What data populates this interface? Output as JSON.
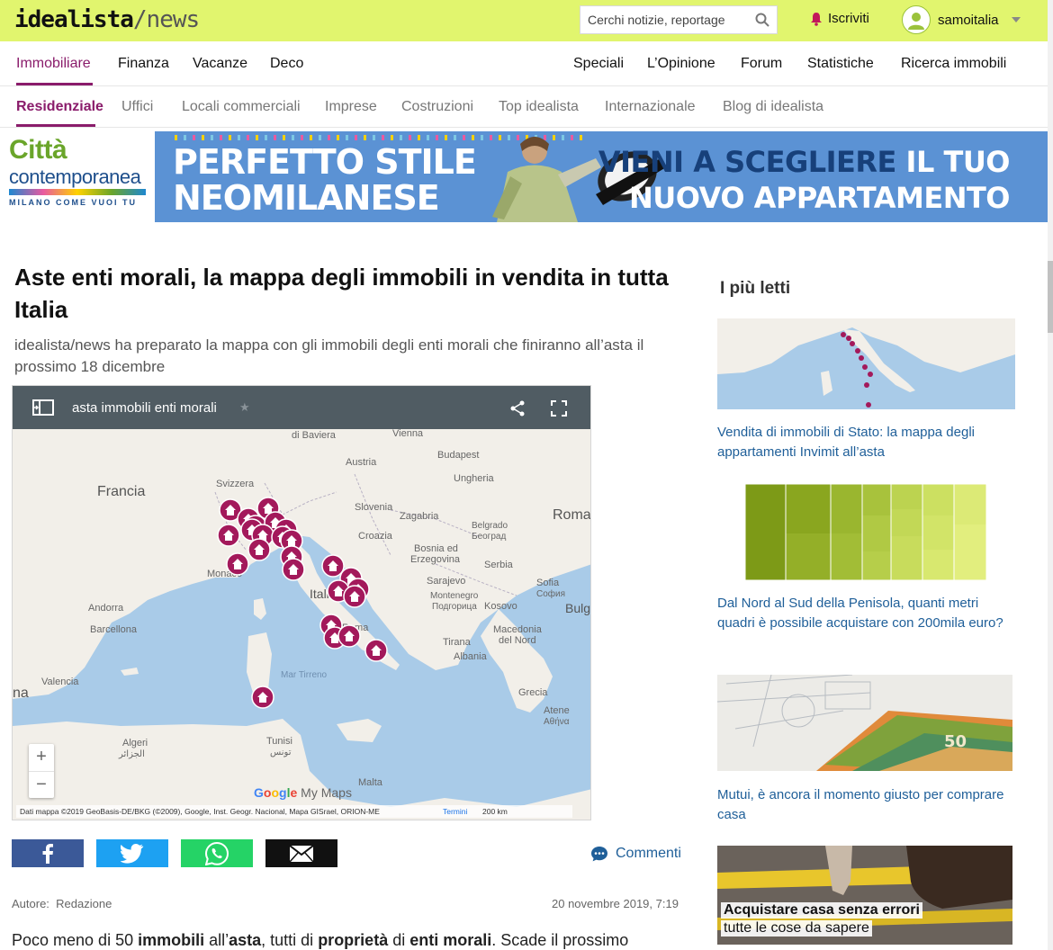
{
  "header": {
    "logo_main": "idealista",
    "logo_slash": "/",
    "logo_news": "news",
    "search_placeholder": "Cerchi notizie, reportage",
    "subscribe_label": "Iscriviti",
    "username": "samoitalia"
  },
  "mainnav": {
    "items": [
      "Immobiliare",
      "Finanza",
      "Vacanze",
      "Deco",
      "Speciali",
      "L’Opinione",
      "Forum",
      "Statistiche",
      "Ricerca immobili"
    ]
  },
  "subnav": {
    "items": [
      "Residenziale",
      "Uffici",
      "Locali commerciali",
      "Imprese",
      "Costruzioni",
      "Top idealista",
      "Internazionale",
      "Blog di idealista"
    ]
  },
  "banner": {
    "brand_line1": "Città",
    "brand_line2": "contemporanea",
    "brand_line3": "MILANO COME VUOI TU",
    "headline_left_1": "PERFETTO STILE",
    "headline_left_2": "NEOMILANESE",
    "headline_right_dark": "VIENI A SCEGLIERE",
    "headline_right_1": " IL TUO",
    "headline_right_2": "NUOVO APPARTAMENTO"
  },
  "article": {
    "title": "Aste enti morali, la mappa degli immobili in vendita in tutta Italia",
    "subtitle": "idealista/news ha preparato la mappa con gli immobili degli enti morali che finiranno all’asta il prossimo 18 dicembre",
    "author_label": "Autore:",
    "author": "Redazione",
    "date": "20 novembre 2019, 7:19",
    "comments_label": "Commenti",
    "body_start": "Poco meno di 50 ",
    "body_b1": "immobili",
    "body_t2": " all’",
    "body_b2": "asta",
    "body_t3": ", tutti di ",
    "body_b3": "proprietà",
    "body_t4": " di ",
    "body_b4": "enti morali",
    "body_t5": ". Scade il prossimo"
  },
  "map": {
    "title": "asta immobili enti morali",
    "star": "★",
    "zoom_in": "+",
    "zoom_out": "−",
    "google_g": "G",
    "google_o1": "o",
    "google_o2": "o",
    "google_g2": "g",
    "google_l": "l",
    "google_e": "e",
    "my_maps": " My Maps",
    "attribution": "Dati mappa ©2019 GeoBasis-DE/BKG (©2009), Google, Inst. Geogr. Nacional, Mapa GISrael, ORION-ME",
    "terms": "Termini",
    "scale": "200 km",
    "labels": {
      "baviera": "di Baviera",
      "vienna": "Vienna",
      "austria": "Austria",
      "budapest": "Budapest",
      "francia": "Francia",
      "svizzera": "Svizzera",
      "ungheria": "Ungheria",
      "slovenia": "Slovenia",
      "zagabria": "Zagabria",
      "roma_ro": "Roma",
      "belgrado": "Belgrado",
      "beograd": "Београд",
      "croazia": "Croazia",
      "bosnia": "Bosnia ed",
      "erzegovina": "Erzegovina",
      "serbia": "Serbia",
      "sarajevo": "Sarajevo",
      "monaco": "Monaco",
      "italia": "Italia",
      "sofia1": "Sofia",
      "sofia2": "София",
      "montenegro": "Montenegro",
      "podgorica": "Подгорица",
      "kosovo": "Kosovo",
      "bulg": "Bulg",
      "andorra": "Andorra",
      "barcellona": "Barcellona",
      "macedonia1": "Macedonia",
      "macedonia2": "del Nord",
      "roma": "Roma",
      "tirana": "Tirana",
      "albania": "Albania",
      "valencia": "Valencia",
      "mar_tirreno": "Mar Tirreno",
      "spagna": "na",
      "grecia": "Grecia",
      "atene1": "Atene",
      "atene2": "Αθήνα",
      "algeri1": "Algeri",
      "algeri2": "الجزائر",
      "tunisi1": "Tunisi",
      "tunisi2": "تونس",
      "malta": "Malta"
    }
  },
  "sidebar": {
    "title": "I più letti",
    "articles": [
      {
        "title": "Vendita di immobili di Stato: la mappa degli appartamenti Invimit all’asta"
      },
      {
        "title": "Dal Nord al Sud della Penisola, quanti metri quadri è possibile acquistare con 200mila euro?"
      },
      {
        "title": "Mutui, è ancora il momento giusto per comprare casa"
      },
      {
        "title": "",
        "caption_1": "Acquistare casa senza errori",
        "caption_2": "tutte le cose da sapere"
      }
    ]
  },
  "colors": {
    "topbar": "#e1f56e",
    "accent": "#8a1c6b",
    "link": "#1f5f99",
    "pin": "#a3195b"
  }
}
